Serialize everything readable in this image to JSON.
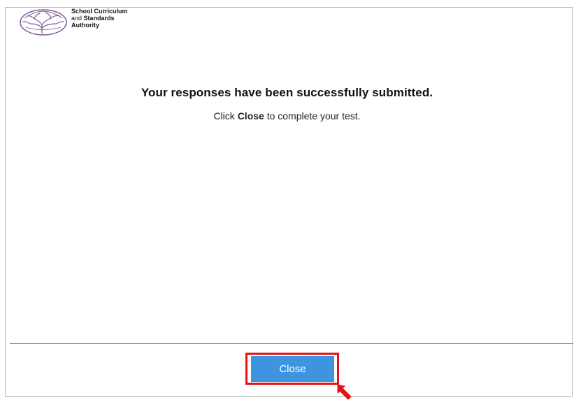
{
  "branding": {
    "org_line1": "School Curriculum",
    "org_line2_prefix": "and",
    "org_line2_bold": "Standards",
    "org_line3": "Authority",
    "logo_icon": "tree-logo-icon",
    "logo_color": "#7a5a9a"
  },
  "message": {
    "title": "Your responses have been successfully submitted.",
    "instruction_prefix": "Click",
    "instruction_bold": "Close",
    "instruction_suffix": "to complete your test."
  },
  "footer": {
    "close_label": "Close",
    "button_color": "#3f94df",
    "highlight_color": "#e51414"
  },
  "annotation": {
    "cursor_icon": "red-arrow-cursor-icon"
  }
}
